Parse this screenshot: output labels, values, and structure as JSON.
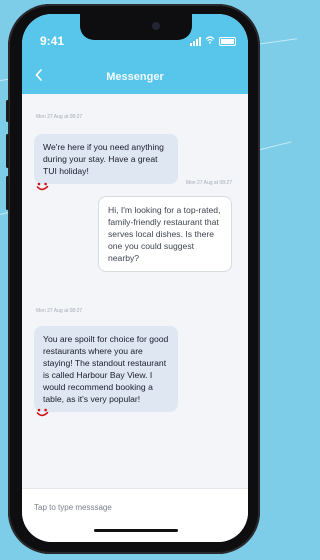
{
  "status_bar": {
    "time": "9:41"
  },
  "header": {
    "title": "Messenger",
    "back_icon": "chevron-left-icon"
  },
  "messages": [
    {
      "sender": "agent",
      "timestamp": "Mon 27 Aug at 08:27",
      "text": "We're here if you need anything during your stay. Have a great TUI holiday!"
    },
    {
      "sender": "user",
      "timestamp": "Mon 27 Aug at 08:27",
      "text": "Hi, I'm looking for a top-rated, family-friendly restaurant that serves local dishes. Is there one you could suggest nearby?"
    },
    {
      "sender": "agent",
      "timestamp": "Mon 27 Aug at 08:27",
      "text": "You are spoilt for choice for good restaurants where you are staying! The standout restaurant is called Harbour Bay View. I would recommend booking a table, as it's very popular!"
    }
  ],
  "input": {
    "placeholder": "Tap to type messsage"
  },
  "colors": {
    "accent": "#58c6ea",
    "agent_bubble": "#dfe7f3",
    "background": "#7dcde8",
    "tui_red": "#d40e14"
  }
}
